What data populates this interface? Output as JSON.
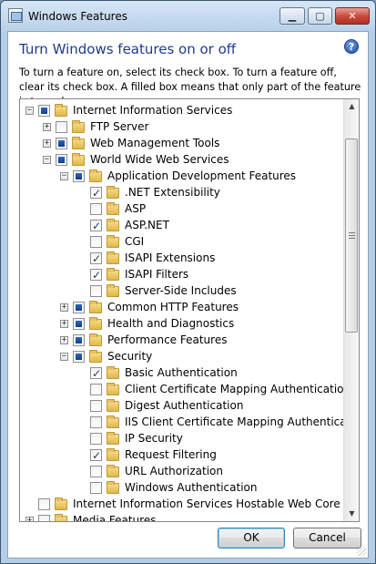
{
  "window": {
    "title": "Windows Features",
    "minimize_glyph": "▁",
    "maximize_glyph": "▢",
    "close_glyph": "✕"
  },
  "header": {
    "title": "Turn Windows features on or off",
    "help_glyph": "?",
    "instructions": "To turn a feature on, select its check box. To turn a feature off, clear its check box. A filled box means that only part of the feature is turned on."
  },
  "tree": {
    "rows": [
      {
        "label": "Internet Information Services",
        "level": 0,
        "expander": "-",
        "state": "partial"
      },
      {
        "label": "FTP Server",
        "level": 1,
        "expander": "+",
        "state": "unchecked"
      },
      {
        "label": "Web Management Tools",
        "level": 1,
        "expander": "+",
        "state": "partial"
      },
      {
        "label": "World Wide Web Services",
        "level": 1,
        "expander": "-",
        "state": "partial"
      },
      {
        "label": "Application Development Features",
        "level": 2,
        "expander": "-",
        "state": "partial"
      },
      {
        "label": ".NET Extensibility",
        "level": 3,
        "expander": "",
        "state": "checked"
      },
      {
        "label": "ASP",
        "level": 3,
        "expander": "",
        "state": "unchecked"
      },
      {
        "label": "ASP.NET",
        "level": 3,
        "expander": "",
        "state": "checked"
      },
      {
        "label": "CGI",
        "level": 3,
        "expander": "",
        "state": "unchecked"
      },
      {
        "label": "ISAPI Extensions",
        "level": 3,
        "expander": "",
        "state": "checked"
      },
      {
        "label": "ISAPI Filters",
        "level": 3,
        "expander": "",
        "state": "checked"
      },
      {
        "label": "Server-Side Includes",
        "level": 3,
        "expander": "",
        "state": "unchecked"
      },
      {
        "label": "Common HTTP Features",
        "level": 2,
        "expander": "+",
        "state": "partial"
      },
      {
        "label": "Health and Diagnostics",
        "level": 2,
        "expander": "+",
        "state": "partial"
      },
      {
        "label": "Performance Features",
        "level": 2,
        "expander": "+",
        "state": "partial"
      },
      {
        "label": "Security",
        "level": 2,
        "expander": "-",
        "state": "partial"
      },
      {
        "label": "Basic Authentication",
        "level": 3,
        "expander": "",
        "state": "checked"
      },
      {
        "label": "Client Certificate Mapping Authentication",
        "level": 3,
        "expander": "",
        "state": "unchecked"
      },
      {
        "label": "Digest Authentication",
        "level": 3,
        "expander": "",
        "state": "unchecked"
      },
      {
        "label": "IIS Client Certificate Mapping Authentication",
        "level": 3,
        "expander": "",
        "state": "unchecked"
      },
      {
        "label": "IP Security",
        "level": 3,
        "expander": "",
        "state": "unchecked"
      },
      {
        "label": "Request Filtering",
        "level": 3,
        "expander": "",
        "state": "checked"
      },
      {
        "label": "URL Authorization",
        "level": 3,
        "expander": "",
        "state": "unchecked"
      },
      {
        "label": "Windows Authentication",
        "level": 3,
        "expander": "",
        "state": "unchecked"
      },
      {
        "label": "Internet Information Services Hostable Web Core",
        "level": 0,
        "expander": "",
        "state": "unchecked"
      },
      {
        "label": "Media Features",
        "level": 0,
        "expander": "+",
        "state": "unchecked"
      }
    ]
  },
  "scrollbar": {
    "up_glyph": "▲",
    "down_glyph": "▼"
  },
  "buttons": {
    "ok": "OK",
    "cancel": "Cancel"
  },
  "colors": {
    "title_blue": "#1e3b8a",
    "partial_fill": "#1f4fa7",
    "folder_yellow": "#e8c060"
  }
}
